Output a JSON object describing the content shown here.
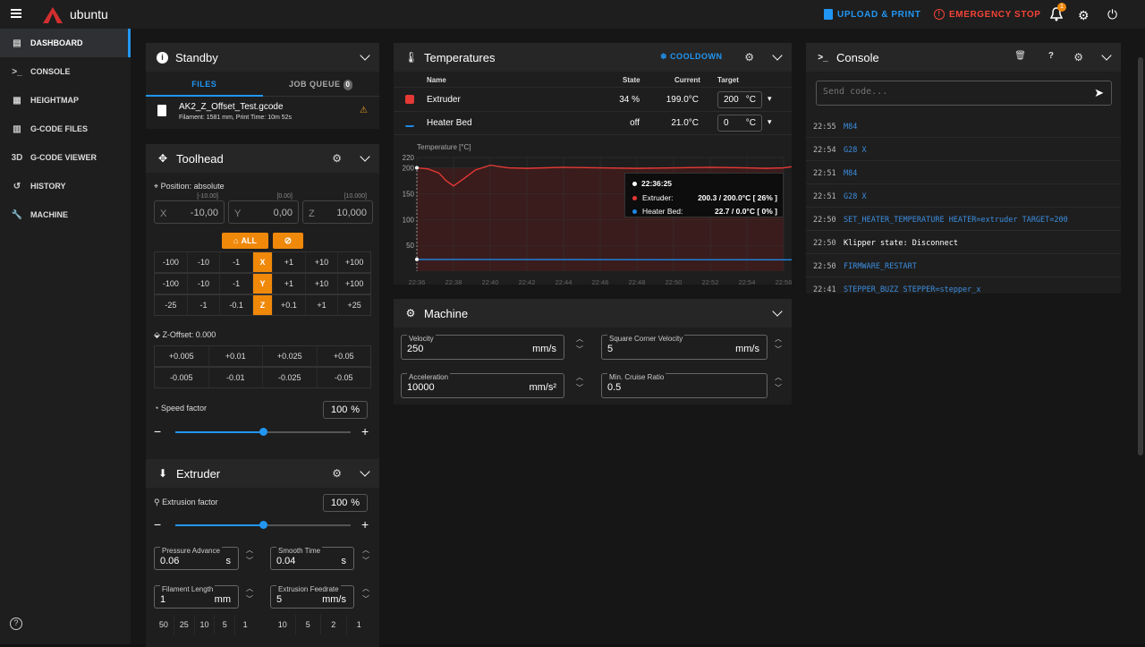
{
  "app": {
    "title": "ubuntu",
    "notif_count": "1"
  },
  "topbar": {
    "upload": "UPLOAD & PRINT",
    "estop": "EMERGENCY STOP",
    "accent": "#2196f3",
    "estop_color": "#f44336"
  },
  "nav": [
    {
      "label": "DASHBOARD",
      "icon": "dashboard-icon"
    },
    {
      "label": "CONSOLE",
      "icon": "console-icon"
    },
    {
      "label": "HEIGHTMAP",
      "icon": "heightmap-icon"
    },
    {
      "label": "G-CODE FILES",
      "icon": "files-icon"
    },
    {
      "label": "G-CODE VIEWER",
      "icon": "viewer-3d-icon"
    },
    {
      "label": "HISTORY",
      "icon": "history-icon"
    },
    {
      "label": "MACHINE",
      "icon": "wrench-icon"
    }
  ],
  "standby": {
    "title": "Standby",
    "tab_files": "FILES",
    "tab_queue": "JOB QUEUE",
    "queue_count": "0",
    "file_name": "AK2_Z_Offset_Test.gcode",
    "file_meta": "Filament: 1581 mm, Print Time: 10m 52s"
  },
  "toolhead": {
    "title": "Toolhead",
    "position_label": "Position: absolute",
    "axes": [
      {
        "label": "X",
        "value": "-10,00",
        "hint": "[-10.00]"
      },
      {
        "label": "Y",
        "value": "0,00",
        "hint": "[0.00]"
      },
      {
        "label": "Z",
        "value": "10,000",
        "hint": "[10.000]"
      }
    ],
    "home_all": "ALL",
    "x_row": [
      "-100",
      "-10",
      "-1",
      "X",
      "+1",
      "+10",
      "+100"
    ],
    "y_row": [
      "-100",
      "-10",
      "-1",
      "Y",
      "+1",
      "+10",
      "+100"
    ],
    "z_row": [
      "-25",
      "-1",
      "-0.1",
      "Z",
      "+0.1",
      "+1",
      "+25"
    ],
    "zoffset_label": "Z-Offset: 0.000",
    "zoff_up": [
      "+0.005",
      "+0.01",
      "+0.025",
      "+0.05"
    ],
    "zoff_down": [
      "-0.005",
      "-0.01",
      "-0.025",
      "-0.05"
    ],
    "speed_label": "Speed factor",
    "speed_value": "100",
    "speed_unit": "%",
    "speed_fraction": 0.5
  },
  "extruder": {
    "title": "Extruder",
    "factor_label": "Extrusion factor",
    "factor_value": "100",
    "factor_unit": "%",
    "factor_fraction": 0.5,
    "pa_label": "Pressure Advance",
    "pa_value": "0.06",
    "pa_unit": "s",
    "st_label": "Smooth Time",
    "st_value": "0.04",
    "st_unit": "s",
    "fl_label": "Filament Length",
    "fl_value": "1",
    "fl_unit": "mm",
    "ef_label": "Extrusion Feedrate",
    "ef_value": "5",
    "ef_unit": "mm/s",
    "len_presets": [
      "50",
      "25",
      "10",
      "5",
      "1"
    ],
    "feed_presets": [
      "10",
      "5",
      "2",
      "1"
    ]
  },
  "temps": {
    "title": "Temperatures",
    "cooldown": "COOLDOWN",
    "headers": {
      "name": "Name",
      "state": "State",
      "current": "Current",
      "target": "Target"
    },
    "rows": [
      {
        "name": "Extruder",
        "state": "34 %",
        "current": "199.0°C",
        "target": "200",
        "unit": "°C",
        "color": "#e53935"
      },
      {
        "name": "Heater Bed",
        "state": "off",
        "current": "21.0°C",
        "target": "0",
        "unit": "°C",
        "color": "#1e88e5"
      }
    ],
    "tooltip": {
      "time": "22:36:25",
      "ext_label": "Extruder:",
      "ext_val": "200.3 / 200.0°C [ 26% ]",
      "bed_label": "Heater Bed:",
      "bed_val": "22.7 / 0.0°C [ 0% ]"
    }
  },
  "chart_data": {
    "type": "line",
    "ylabel": "Temperature [°C]",
    "ylim": [
      0,
      220
    ],
    "y_ticks": [
      "220",
      "200",
      "150",
      "100",
      "50"
    ],
    "x_ticks": [
      "22:36",
      "22:38",
      "22:40",
      "22:42",
      "22:44",
      "22:46",
      "22:48",
      "22:50",
      "22:52",
      "22:54",
      "22:56"
    ],
    "series": [
      {
        "name": "Extruder",
        "color": "#e53935",
        "x": [
          0,
          0.3,
          0.6,
          0.8,
          1.0,
          1.3,
          1.6,
          2,
          2.5,
          3,
          4,
          5,
          6,
          7,
          8,
          9,
          9.5,
          10,
          10.3,
          10.6
        ],
        "y": [
          200,
          198,
          190,
          175,
          165,
          180,
          196,
          205,
          200,
          199,
          201,
          200,
          199,
          200,
          201,
          200,
          199,
          200,
          203,
          200
        ]
      },
      {
        "name": "Heater Bed",
        "color": "#1e88e5",
        "x": [
          0,
          10.6
        ],
        "y": [
          22.7,
          22
        ]
      }
    ]
  },
  "machine": {
    "title": "Machine",
    "velocity_label": "Velocity",
    "velocity_value": "250",
    "velocity_unit": "mm/s",
    "scv_label": "Square Corner Velocity",
    "scv_value": "5",
    "scv_unit": "mm/s",
    "accel_label": "Acceleration",
    "accel_value": "10000",
    "accel_unit": "mm/s²",
    "mcr_label": "Min. Cruise Ratio",
    "mcr_value": "0.5"
  },
  "console": {
    "title": "Console",
    "placeholder": "Send code...",
    "lines": [
      {
        "time": "22:55",
        "cmd": "M84"
      },
      {
        "time": "22:54",
        "cmd": "G28 X"
      },
      {
        "time": "22:51",
        "cmd": "M84"
      },
      {
        "time": "22:51",
        "cmd": "G28 X"
      },
      {
        "time": "22:50",
        "cmd": "SET_HEATER_TEMPERATURE HEATER=extruder TARGET=200"
      },
      {
        "time": "22:50",
        "cmd": "Klipper state: Disconnect"
      },
      {
        "time": "22:50",
        "cmd": "FIRMWARE_RESTART"
      },
      {
        "time": "22:41",
        "cmd": "STEPPER_BUZZ STEPPER=stepper_x"
      }
    ]
  }
}
